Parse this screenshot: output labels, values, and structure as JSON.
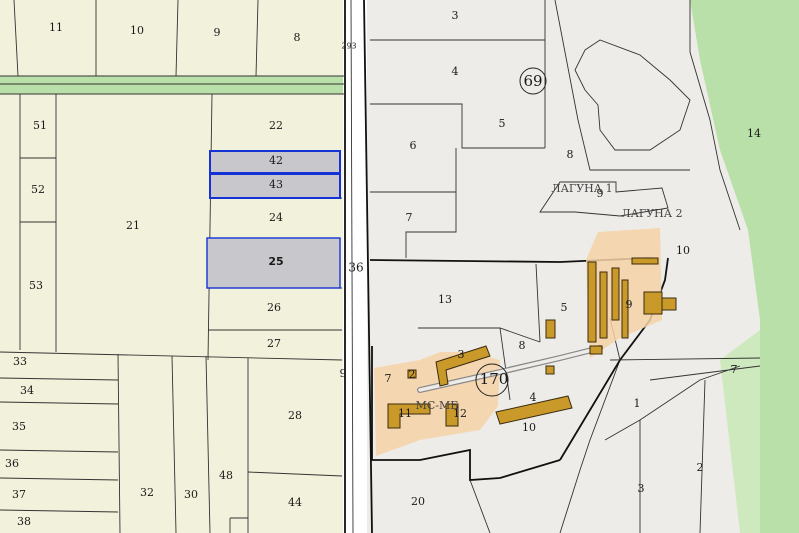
{
  "road_label": "293",
  "circles": [
    {
      "id": "69",
      "label": "69"
    },
    {
      "id": "170",
      "label": "170"
    }
  ],
  "names": {
    "laguna1": "ЛАГУНА 1",
    "laguna2": "ЛАГУНА 2",
    "mcmg": "МС-МБ"
  },
  "parcels_left": {
    "p11": "11",
    "p10": "10",
    "p9": "9",
    "p8": "8",
    "p51": "51",
    "p52": "52",
    "p53": "53",
    "p21": "21",
    "p22": "22",
    "p42": "42",
    "p43": "43",
    "p24": "24",
    "p25": "25",
    "p26": "26",
    "p27": "27",
    "p33": "33",
    "p34": "34",
    "p35": "35",
    "p36": "36",
    "p37": "37",
    "p38": "38",
    "p32": "32",
    "p30": "30",
    "p48": "48",
    "p28": "28",
    "p44": "44"
  },
  "parcels_right": {
    "p3": "3",
    "p4": "4",
    "p5": "5",
    "p6": "6",
    "p7": "7",
    "p8": "8",
    "p9a": "9",
    "p10": "10",
    "p14": "14",
    "p36": "36",
    "p13": "13",
    "p5b": "5",
    "p9b": "9",
    "p7b": "7",
    "p2b": "2",
    "p3b": "3",
    "p8b": "8",
    "p11": "11",
    "p12": "12",
    "p4b": "4",
    "p10b": "10",
    "p20": "20",
    "p7c": "7",
    "p9c": "9",
    "p2c": "2",
    "p3c": "3",
    "p1": "1"
  },
  "colors": {
    "cream": "#f1f1dc",
    "green": "#b9e0a8",
    "grey_area": "#eeece8",
    "highlight_fill": "#c8c8cc",
    "highlight_stroke": "#1432d6",
    "orange_zone": "#f4d2a6",
    "building": "#c9992a"
  }
}
